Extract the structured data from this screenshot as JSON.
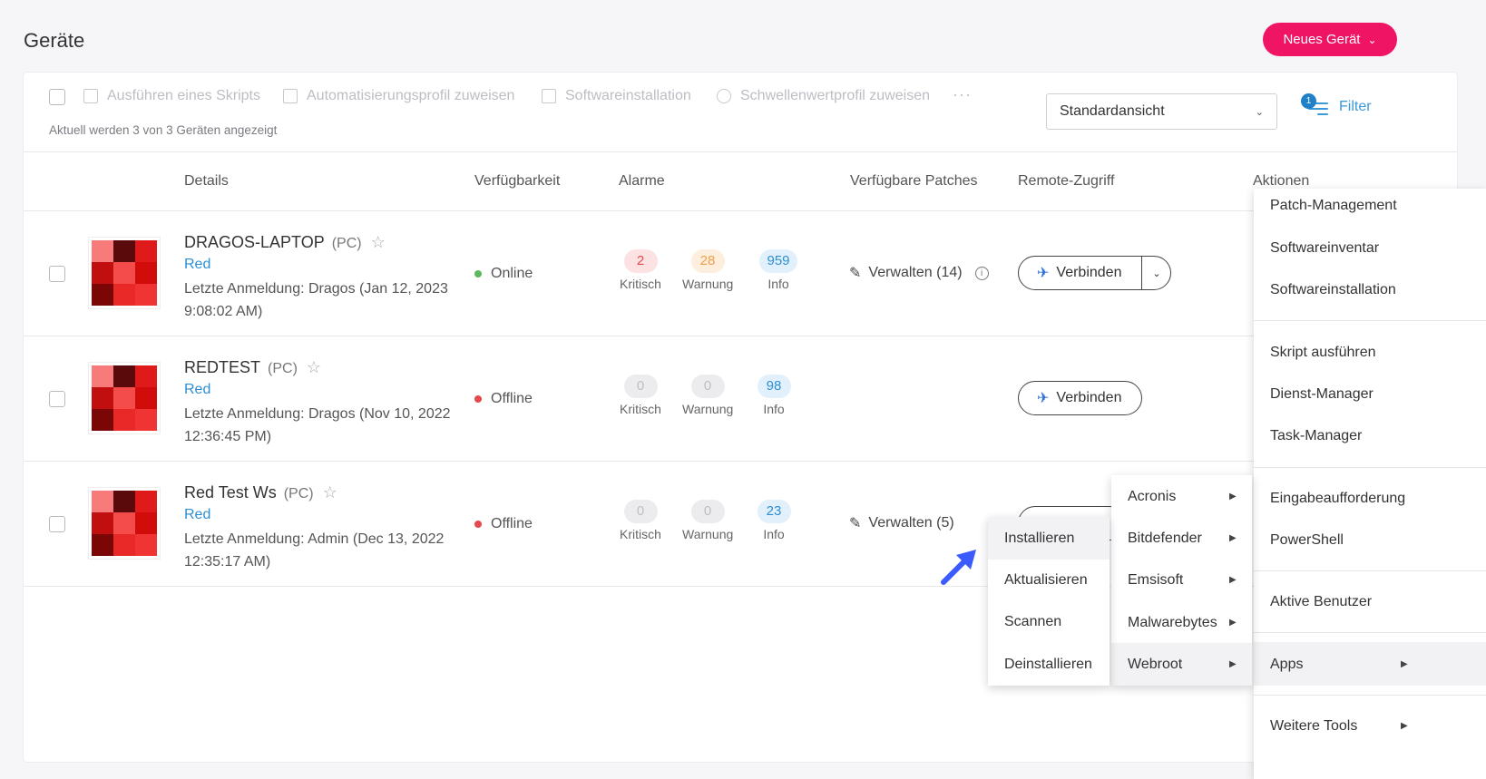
{
  "page": {
    "title": "Geräte",
    "new_device": "Neues Gerät"
  },
  "toolbar": {
    "actions": [
      "Ausführen eines Skripts",
      "Automatisierungsprofil zuweisen",
      "Softwareinstallation",
      "Schwellenwertprofil zuweisen"
    ],
    "more": "···",
    "showing": "Aktuell werden 3 von 3 Geräten angezeigt",
    "view": "Standardansicht",
    "filter_label": "Filter",
    "filter_count": "1"
  },
  "columns": [
    "Details",
    "Verfügbarkeit",
    "Alarme",
    "Verfügbare Patches",
    "Remote-Zugriff",
    "Aktionen"
  ],
  "alarm_labels": {
    "critical": "Kritisch",
    "warning": "Warnung",
    "info": "Info"
  },
  "rows": [
    {
      "name": "DRAGOS-LAPTOP",
      "type": "(PC)",
      "group": "Red",
      "login": "Letzte Anmeldung: Dragos (Jan 12, 2023 9:08:02 AM)",
      "status": "Online",
      "critical": "2",
      "warning": "28",
      "info": "959",
      "patches": "Verwalten (14)",
      "connect": "Verbinden"
    },
    {
      "name": "REDTEST",
      "type": "(PC)",
      "group": "Red",
      "login": "Letzte Anmeldung: Dragos (Nov 10, 2022 12:36:45 PM)",
      "status": "Offline",
      "critical": "0",
      "warning": "0",
      "info": "98",
      "patches": "",
      "connect": "Verbinden"
    },
    {
      "name": "Red Test Ws",
      "type": "(PC)",
      "group": "Red",
      "login": "Letzte Anmeldung: Admin (Dec 13, 2022 12:35:17 AM)",
      "status": "Offline",
      "critical": "0",
      "warning": "0",
      "info": "23",
      "patches": "Verwalten (5)",
      "connect": ""
    }
  ],
  "actions_menu": [
    "Patch-Management",
    "Softwareinventar",
    "Softwareinstallation",
    "Skript ausführen",
    "Dienst-Manager",
    "Task-Manager",
    "Eingabeaufforderung",
    "PowerShell",
    "Aktive Benutzer",
    "Apps",
    "Weitere Tools"
  ],
  "apps_menu": [
    "Acronis",
    "Bitdefender",
    "Emsisoft",
    "Malwarebytes",
    "Webroot"
  ],
  "webroot_menu": [
    "Installieren",
    "Aktualisieren",
    "Scannen",
    "Deinstallieren"
  ],
  "colors": {
    "accent": "#f01464",
    "link": "#2d8fd5",
    "online": "#5cb85c",
    "offline": "#e5484d"
  }
}
